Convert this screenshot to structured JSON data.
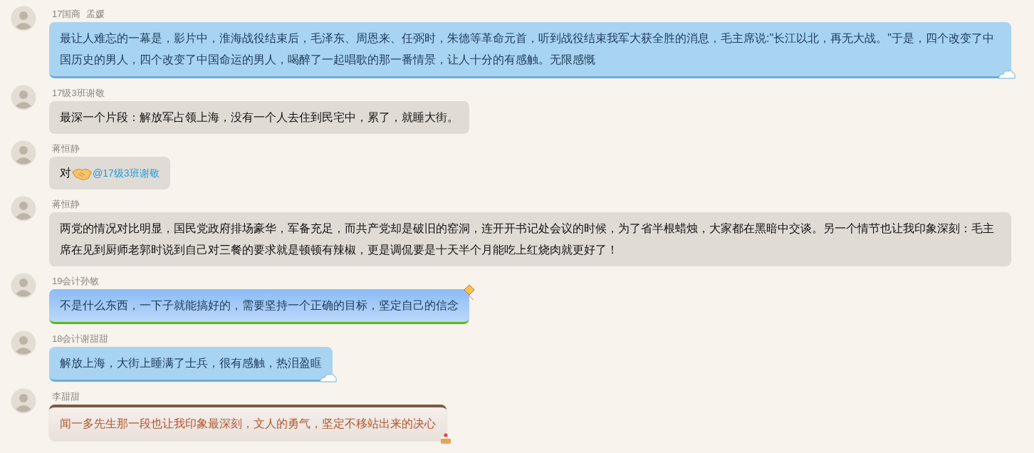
{
  "messages": [
    {
      "sender": "17国商  孟媛",
      "kind": "cloud",
      "parts": [
        {
          "kind": "text",
          "text": "最让人难忘的一幕是，影片中，淮海战役结束后，毛泽东、周恩来、任弼时，朱德等革命元首，听到战役结束我军大获全胜的消息，毛主席说:\"长江以北，再无大战。\"于是，四个改变了中国历史的男人，四个改变了中国命运的男人，喝醉了一起唱歌的那一番情景，让人十分的有感触。无限感慨"
        }
      ]
    },
    {
      "sender": "17级3班谢敬",
      "kind": "plain",
      "parts": [
        {
          "kind": "text",
          "text": "最深一个片段：解放军占领上海，没有一个人去住到民宅中，累了，就睡大街。"
        }
      ]
    },
    {
      "sender": "蒋恒静",
      "kind": "plain",
      "parts": [
        {
          "kind": "text",
          "text": "对"
        },
        {
          "kind": "emoji"
        },
        {
          "kind": "mention",
          "text": "@17级3班谢敬"
        }
      ]
    },
    {
      "sender": "蒋恒静",
      "kind": "plain",
      "parts": [
        {
          "kind": "text",
          "text": "两党的情况对比明显，国民党政府排场豪华，军备充足，而共产党却是破旧的窑洞，连开开书记处会议的时候，为了省半根蜡烛，大家都在黑暗中交谈。另一个情节也让我印象深刻：毛主席在见到厨师老郭时说到自己对三餐的要求就是顿顿有辣椒，更是调侃要是十天半个月能吃上红烧肉就更好了！"
        }
      ]
    },
    {
      "sender": "19会计孙敏",
      "kind": "kite",
      "parts": [
        {
          "kind": "text",
          "text": "不是什么东西，一下子就能搞好的，需要坚持一个正确的目标，坚定自己的信念"
        }
      ]
    },
    {
      "sender": "18会计谢甜甜",
      "kind": "cloud",
      "parts": [
        {
          "kind": "text",
          "text": "解放上海，大街上睡满了士兵，很有感触，热泪盈眶"
        }
      ]
    },
    {
      "sender": "李甜甜",
      "kind": "cake",
      "parts": [
        {
          "kind": "text",
          "text": "闻一多先生那一段也让我印象最深刻，文人的勇气，坚定不移站出来的决心"
        }
      ]
    }
  ]
}
